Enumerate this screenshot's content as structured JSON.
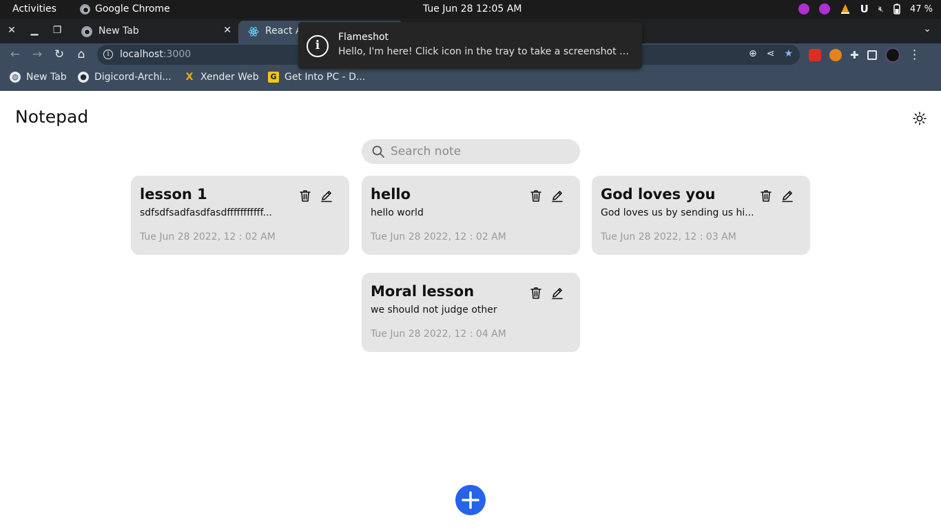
{
  "system_bar": {
    "activities": "Activities",
    "app_name": "Google Chrome",
    "clock": "Tue Jun 28  12:05 AM",
    "battery": "47 %"
  },
  "browser": {
    "tabs": [
      {
        "title": "New Tab",
        "active": false
      },
      {
        "title": "React A",
        "active": true
      }
    ],
    "url_host": "localhost",
    "url_port": ":3000",
    "bookmarks": [
      {
        "label": "New Tab",
        "icon": "globe-icon"
      },
      {
        "label": "Digicord-Archi...",
        "icon": "github-icon"
      },
      {
        "label": "Xender Web",
        "icon": "xender-icon"
      },
      {
        "label": "Get Into PC - D...",
        "icon": "getintopc-icon"
      }
    ]
  },
  "notification": {
    "title": "Flameshot",
    "body": "Hello, I'm here! Click icon in the tray to take a screenshot or cli..."
  },
  "app": {
    "title": "Notepad",
    "search_placeholder": "Search note",
    "accent_color": "#2563eb",
    "card_color": "#e5e5e5",
    "notes": [
      {
        "title": "lesson 1",
        "body": "sdfsdfsadfasdfasdfffffffffff...",
        "date": "Tue Jun 28 2022, 12 : 02 AM"
      },
      {
        "title": "hello",
        "body": "hello world",
        "date": "Tue Jun 28 2022, 12 : 02 AM"
      },
      {
        "title": "God loves you",
        "body": "God loves us by sending us hi...",
        "date": "Tue Jun 28 2022, 12 : 03 AM"
      },
      {
        "title": "Moral lesson",
        "body": "we should not judge other",
        "date": "Tue Jun 28 2022, 12 : 04 AM"
      }
    ]
  }
}
